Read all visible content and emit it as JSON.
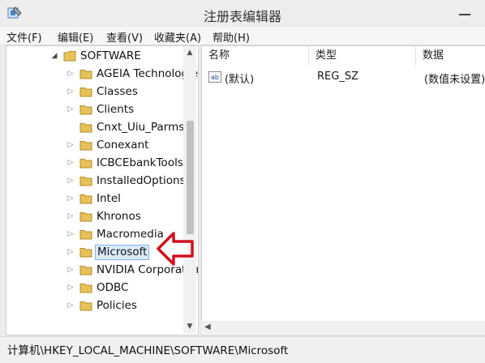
{
  "window": {
    "title": "注册表编辑器"
  },
  "menu": [
    "文件(F)",
    "编辑(E)",
    "查看(V)",
    "收藏夹(A)",
    "帮助(H)"
  ],
  "tree": {
    "root": "SOFTWARE",
    "items": [
      {
        "label": "AGEIA Technologies",
        "expandable": true
      },
      {
        "label": "Classes",
        "expandable": true
      },
      {
        "label": "Clients",
        "expandable": true
      },
      {
        "label": "Cnxt_Uiu_Parms",
        "expandable": false
      },
      {
        "label": "Conexant",
        "expandable": true
      },
      {
        "label": "ICBCEbankTools",
        "expandable": true
      },
      {
        "label": "InstalledOptions",
        "expandable": true
      },
      {
        "label": "Intel",
        "expandable": true
      },
      {
        "label": "Khronos",
        "expandable": true
      },
      {
        "label": "Macromedia",
        "expandable": true
      },
      {
        "label": "Microsoft",
        "expandable": true,
        "selected": true
      },
      {
        "label": "NVIDIA Corporation",
        "expandable": true
      },
      {
        "label": "ODBC",
        "expandable": true
      },
      {
        "label": "Policies",
        "expandable": true
      }
    ]
  },
  "values": {
    "columns": [
      "名称",
      "类型",
      "数据"
    ],
    "rows": [
      {
        "name": "(默认)",
        "type": "REG_SZ",
        "data": "(数值未设置)"
      }
    ]
  },
  "status": {
    "path": "计算机\\HKEY_LOCAL_MACHINE\\SOFTWARE\\Microsoft"
  },
  "colors": {
    "folder": "#e7c15a",
    "selection": "#d9ebfb",
    "arrow": "#d0111b"
  }
}
